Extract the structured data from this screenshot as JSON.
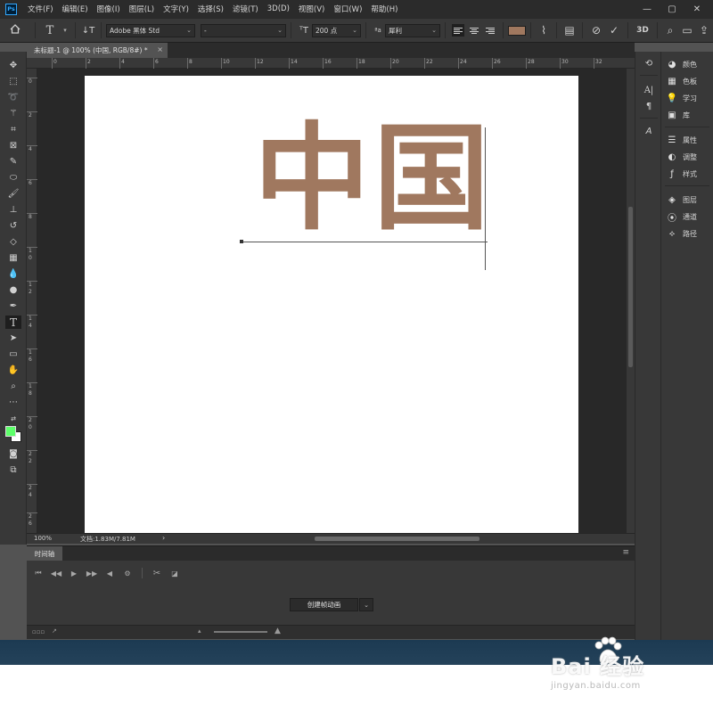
{
  "app": {
    "logo": "Ps",
    "menu": [
      "文件(F)",
      "编辑(E)",
      "图像(I)",
      "图层(L)",
      "文字(Y)",
      "选择(S)",
      "滤镜(T)",
      "3D(D)",
      "视图(V)",
      "窗口(W)",
      "帮助(H)"
    ],
    "window_controls": [
      "—",
      "▢",
      "✕"
    ]
  },
  "options_bar": {
    "font_family": "Adobe 黑体 Std",
    "font_style": "-",
    "font_size": "200 点",
    "antialias": "犀利",
    "text_color": "#a0785f"
  },
  "document_tab": {
    "title": "未标题-1 @ 100% (中国, RGB/8#) *",
    "close": "×"
  },
  "rulers": {
    "horizontal": [
      "0",
      "2",
      "4",
      "6",
      "8",
      "10",
      "12",
      "14",
      "16",
      "18",
      "20",
      "22",
      "24",
      "26",
      "28",
      "30",
      "32"
    ],
    "vertical": [
      "0",
      "2",
      "4",
      "6",
      "8",
      "1\n0",
      "1\n2",
      "1\n4",
      "1\n6",
      "1\n8",
      "2\n0",
      "2\n2",
      "2\n4",
      "2\n6"
    ]
  },
  "canvas": {
    "text": "中国",
    "text_color": "#a0785f",
    "background": "#ffffff"
  },
  "status": {
    "zoom": "100%",
    "doc_size": "文档:1.83M/7.81M",
    "arrow": "›"
  },
  "timeline": {
    "tab_label": "时间轴",
    "create_button": "创建帧动画",
    "menu_icon": "≡"
  },
  "tool_colors": {
    "foreground": "#5dff6a",
    "background": "#ffffff"
  },
  "right_panel": {
    "items": [
      "颜色",
      "色板",
      "学习",
      "库",
      "属性",
      "调整",
      "样式",
      "图层",
      "通道",
      "路径"
    ]
  },
  "watermark": {
    "brand": "Bai  经验",
    "url": "jingyan.baidu.com"
  }
}
